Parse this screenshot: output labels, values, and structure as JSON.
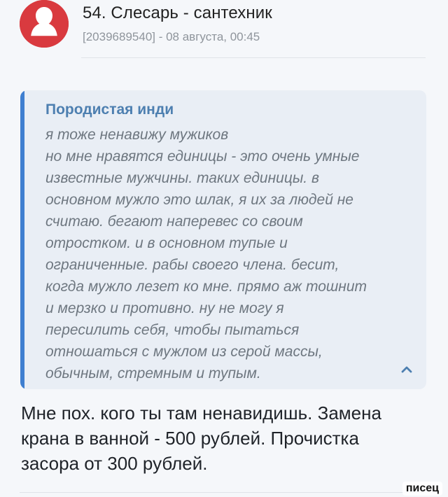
{
  "post": {
    "author": "54. Слесарь - сантехник",
    "meta": "[2039689540] - 08 августа, 00:45",
    "quote": {
      "author": "Породистая инди",
      "text": "я тоже ненавижу мужиков\nно мне нравятся единицы - это очень умные\nизвестные мужчины. таких единицы. в\nосновном мужло это шлак, я их за людей не\nсчитаю. бегают наперевес со своим\nотростком. и в основном тупые и\nограниченные. рабы своего члена. бесит,\nкогда мужло лезет ко мне. прямо аж тошнит\nи мерзко и противно. ну не могу я\nпересилить себя, чтобы пытаться\nотношаться с мужлом из серой массы,\nобычным, стремным и тупым."
    },
    "reply": "Мне пох. кого ты там ненавидишь. Замена\nкрана в ванной - 500 рублей. Прочистка\nзасора от 300 рублей."
  },
  "watermark": "писец",
  "colors": {
    "avatar": "#d93a3f",
    "quote_accent": "#3f7fd0",
    "quote_author": "#4d7fb0",
    "quote_background": "#e9eef5"
  },
  "icons": {
    "avatar": "user-silhouette-icon",
    "collapse": "chevron-up-icon"
  }
}
